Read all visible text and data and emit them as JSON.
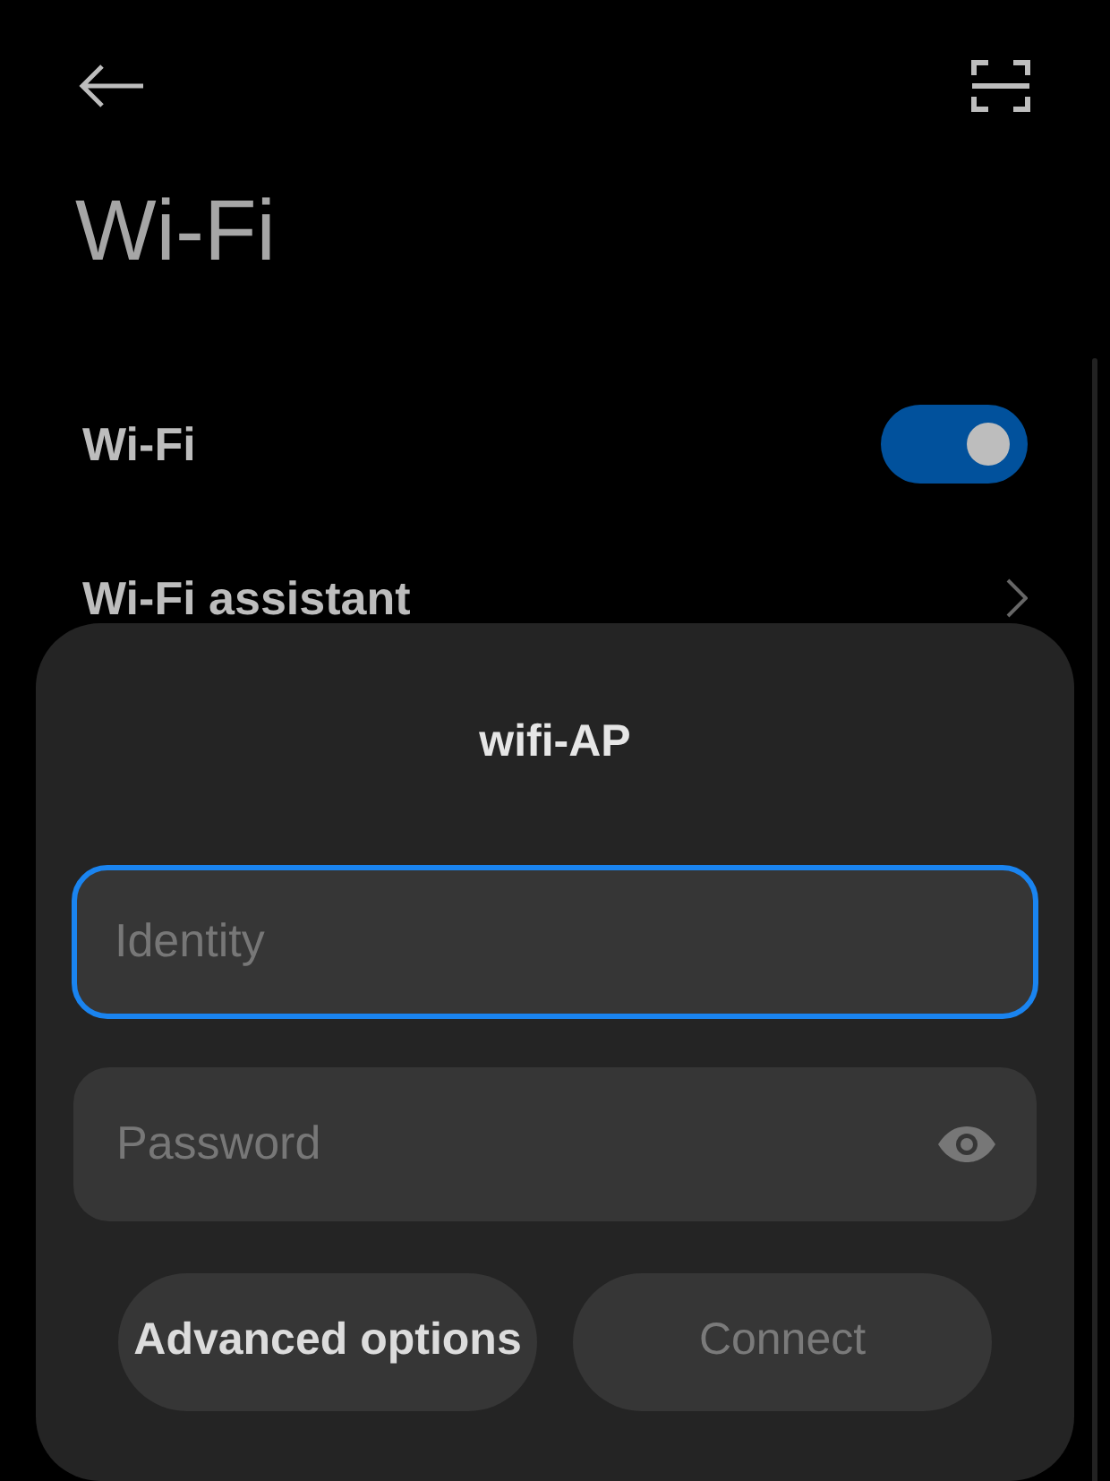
{
  "header": {
    "title": "Wi-Fi"
  },
  "settings": [
    {
      "kind": "toggle",
      "label": "Wi-Fi",
      "on": true
    },
    {
      "kind": "link",
      "label": "Wi-Fi assistant"
    }
  ],
  "dialog": {
    "title": "wifi-AP",
    "fields": [
      {
        "kind": "text",
        "placeholder": "Identity",
        "focused": true
      },
      {
        "kind": "password",
        "placeholder": "Password",
        "focused": false
      }
    ],
    "buttons": [
      {
        "label": "Advanced options",
        "disabled": false
      },
      {
        "label": "Connect",
        "disabled": true
      }
    ]
  }
}
